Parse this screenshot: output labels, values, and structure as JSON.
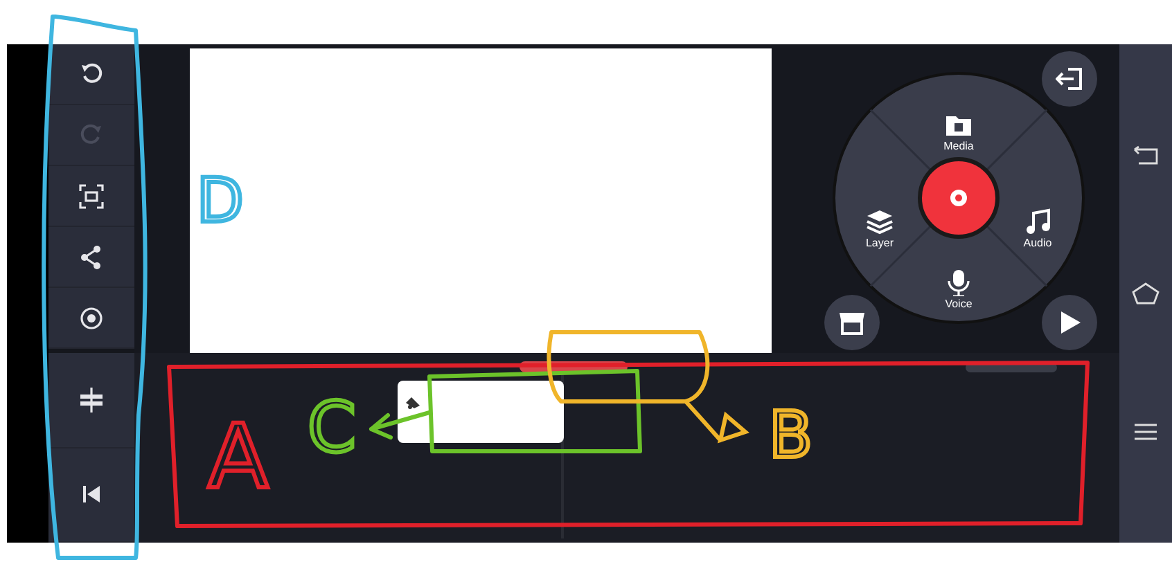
{
  "toolbar": {
    "top": [
      {
        "kind": "undo",
        "disabled": false
      },
      {
        "kind": "redo",
        "disabled": true
      },
      {
        "kind": "crop",
        "disabled": false
      },
      {
        "kind": "share",
        "disabled": false
      },
      {
        "kind": "settings",
        "disabled": false
      }
    ],
    "bottom": [
      {
        "kind": "levels",
        "disabled": false
      },
      {
        "kind": "rewind",
        "disabled": false
      }
    ]
  },
  "wheel": {
    "items": [
      {
        "label": "Media",
        "kind": "media"
      },
      {
        "label": "Layer",
        "kind": "layer"
      },
      {
        "label": "Audio",
        "kind": "audio"
      },
      {
        "label": "Voice",
        "kind": "voice"
      }
    ]
  },
  "annotations": [
    {
      "letter": "D",
      "color": "#3fb6e0"
    },
    {
      "letter": "A",
      "color": "#e0202a"
    },
    {
      "letter": "C",
      "color": "#6cc32a"
    },
    {
      "letter": "B",
      "color": "#f0b52a"
    }
  ]
}
